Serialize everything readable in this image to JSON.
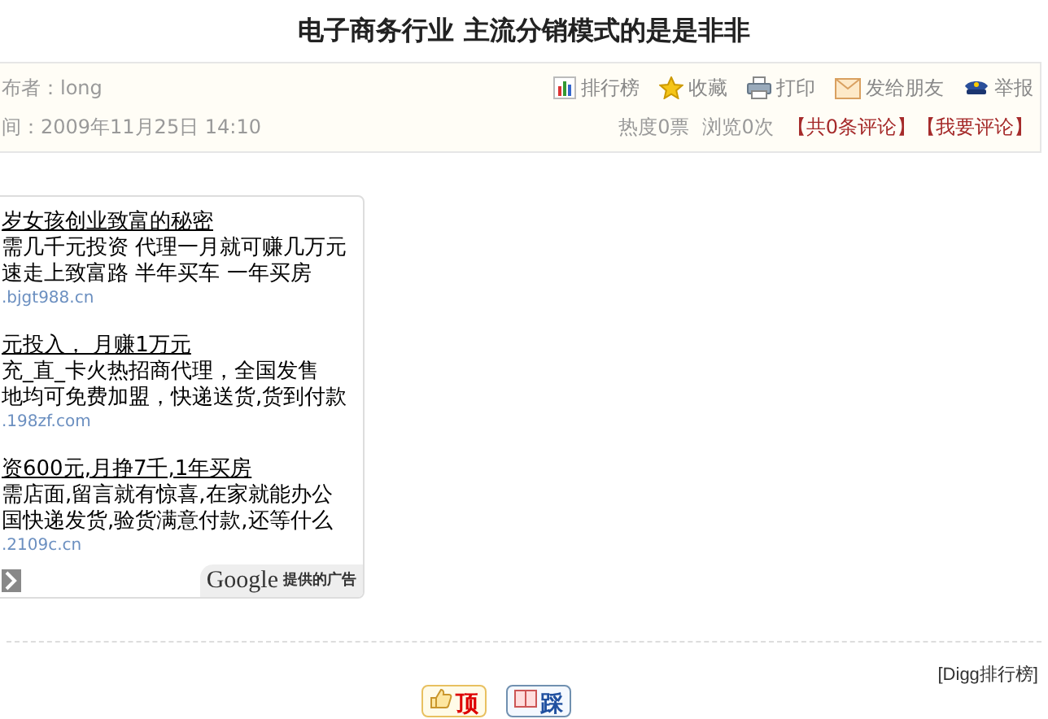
{
  "title": "电子商务行业 主流分销模式的是是非非",
  "meta": {
    "author": "布者：long",
    "time": "间：2009年11月25日  14:10",
    "tools": [
      {
        "kind": "chart",
        "label": "排行榜"
      },
      {
        "kind": "star",
        "label": "收藏"
      },
      {
        "kind": "print",
        "label": "打印"
      },
      {
        "kind": "mail",
        "label": "发给朋友"
      },
      {
        "kind": "report",
        "label": "举报"
      }
    ],
    "stats": [
      "热度0票",
      "浏览0次"
    ],
    "links": [
      "【共0条评论】",
      "【我要评论】"
    ]
  },
  "ads": [
    {
      "title": "岁女孩创业致富的秘密",
      "lines": [
        "需几千元投资 代理一月就可赚几万元",
        "速走上致富路 半年买车 一年买房"
      ],
      "url": ".bjgt988.cn"
    },
    {
      "title": "元投入， 月赚1万元",
      "lines": [
        "充_直_卡火热招商代理，全国发售",
        "地均可免费加盟，快递送货,货到付款"
      ],
      "url": ".198zf.com"
    },
    {
      "title": "资600元,月挣7千,1年买房",
      "lines": [
        "需店面,留言就有惊喜,在家就能办公",
        "国快递发货,验货满意付款,还等什么"
      ],
      "url": ".2109c.cn"
    }
  ],
  "ad_footer": {
    "brand": "Google",
    "label": "提供的广告"
  },
  "digg_link": "[Digg排行榜]",
  "votes": [
    {
      "kind": "up",
      "label": "顶"
    },
    {
      "kind": "down",
      "label": "踩"
    }
  ]
}
